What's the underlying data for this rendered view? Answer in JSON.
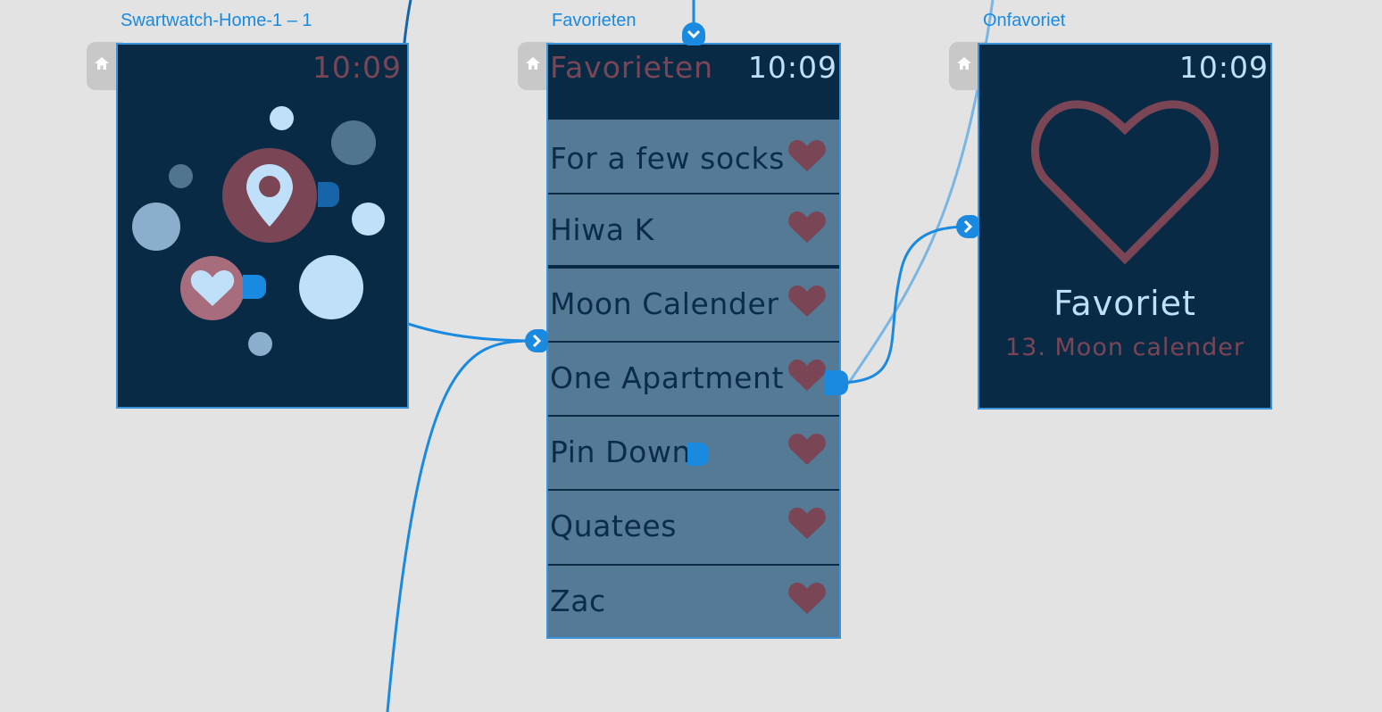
{
  "colors": {
    "canvas": "#e3e3e3",
    "wire": "#1a8ae0",
    "wire_light": "#7ab6e4",
    "screen_bg": "#082a45",
    "row_bg": "#557a96",
    "accent_maroon": "#7a4656",
    "text_light": "#bfe0f8"
  },
  "artboards": [
    {
      "label": "Swartwatch-Home-1 – 1",
      "time": "10:09",
      "icons": [
        "home-icon",
        "location-pin-icon",
        "heart-icon"
      ]
    },
    {
      "label": "Favorieten",
      "title": "Favorieten",
      "time": "10:09",
      "items": [
        {
          "label": "For a few socks",
          "icon": "heart-icon"
        },
        {
          "label": "Hiwa K",
          "icon": "heart-icon"
        },
        {
          "label": "Moon Calender",
          "icon": "heart-icon"
        },
        {
          "label": "One Apartment",
          "icon": "heart-icon"
        },
        {
          "label": "Pin Down",
          "icon": "heart-icon"
        },
        {
          "label": "Quatees",
          "icon": "heart-icon"
        },
        {
          "label": "Zac",
          "icon": "heart-icon"
        }
      ]
    },
    {
      "label": "Onfavoriet",
      "time": "10:09",
      "heading": "Favoriet",
      "subheading": "13. Moon calender",
      "icons": [
        "heart-outline-icon"
      ]
    }
  ]
}
